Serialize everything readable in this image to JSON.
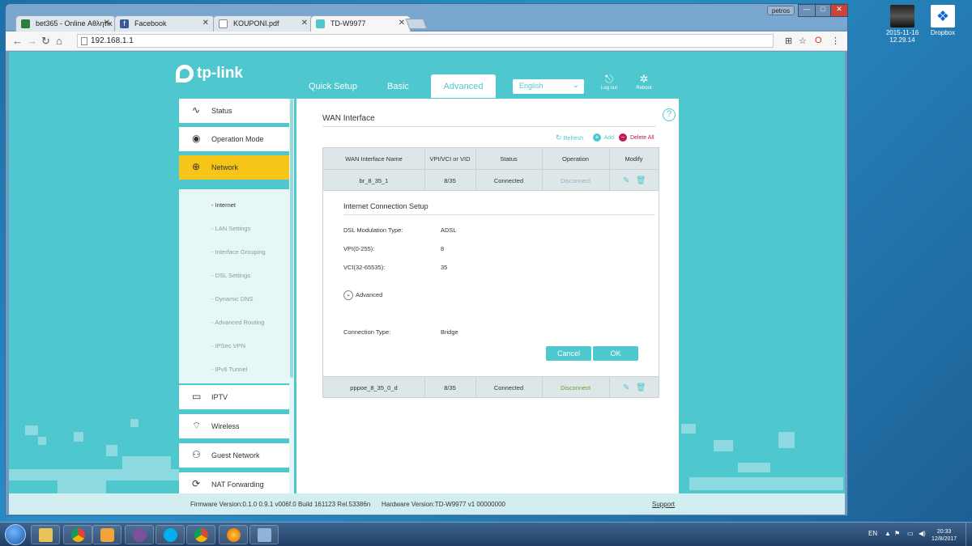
{
  "desktop": {
    "icons": [
      {
        "label": "2015-11-16 12.29.14",
        "icon": "photo-icon"
      },
      {
        "label": "Dropbox",
        "icon": "dropbox-icon"
      }
    ]
  },
  "browser": {
    "user": "petros",
    "tabs": [
      {
        "label": "bet365 - Online Αθλητικ",
        "icon": "bet365-favicon",
        "color": "#2f7d3a"
      },
      {
        "label": "Facebook",
        "icon": "facebook-favicon",
        "color": "#3b5998"
      },
      {
        "label": "KOUPONI.pdf",
        "icon": "document-icon",
        "color": "#888888"
      },
      {
        "label": "TD-W9977",
        "icon": "tplink-favicon",
        "color": "#4fc7cf"
      }
    ],
    "url": "192.168.1.1"
  },
  "router": {
    "brand": "tp-link",
    "nav": [
      "Quick Setup",
      "Basic",
      "Advanced"
    ],
    "language": "English",
    "logout_label": "Log out",
    "reboot_label": "Reboot",
    "sidebar": {
      "items_top": [
        "Status",
        "Operation Mode",
        "Network"
      ],
      "subitems": [
        "- Internet",
        "- LAN Settings",
        "- Interface Grouping",
        "- DSL Settings",
        "- Dynamic DNS",
        "- Advanced Routing",
        "- IPSec VPN",
        "- IPv6 Tunnel"
      ],
      "items_bottom": [
        "IPTV",
        "Wireless",
        "Guest Network",
        "NAT Forwarding"
      ]
    },
    "section_title": "WAN Interface",
    "toolbar": {
      "refresh": "Refresh",
      "add": "Add",
      "delete_all": "Delete All"
    },
    "table": {
      "headers": [
        "WAN Interface Name",
        "VPI/VCI or VID",
        "Status",
        "Operation",
        "Modify"
      ],
      "rows": [
        {
          "name": "br_8_35_1",
          "vpivci": "8/35",
          "status": "Connected",
          "operation": "Disconnect"
        },
        {
          "name": "pppoe_8_35_0_d",
          "vpivci": "8/35",
          "status": "Connected",
          "operation": "Disconnect"
        }
      ]
    },
    "edit": {
      "title": "Internet Connection Setup",
      "fields": [
        {
          "label": "DSL Modulation Type:",
          "value": "ADSL"
        },
        {
          "label": "VPI(0-255):",
          "value": "8"
        },
        {
          "label": "VCI(32-65535):",
          "value": "35"
        }
      ],
      "advanced_label": "Advanced",
      "connection_type_label": "Connection Type:",
      "connection_type_value": "Bridge",
      "cancel": "Cancel",
      "ok": "OK"
    },
    "footer": {
      "firmware": "Firmware Version:0.1.0 0.9.1 v006f.0 Build 161123 Rel.53386n",
      "hardware": "Hardware Version:TD-W9977 v1 00000000",
      "support": "Support"
    }
  },
  "taskbar": {
    "lang": "EN",
    "time": "20:33",
    "date": "12/8/2017"
  },
  "colors": {
    "accent": "#4fc7cf",
    "active_side": "#f7c518"
  }
}
